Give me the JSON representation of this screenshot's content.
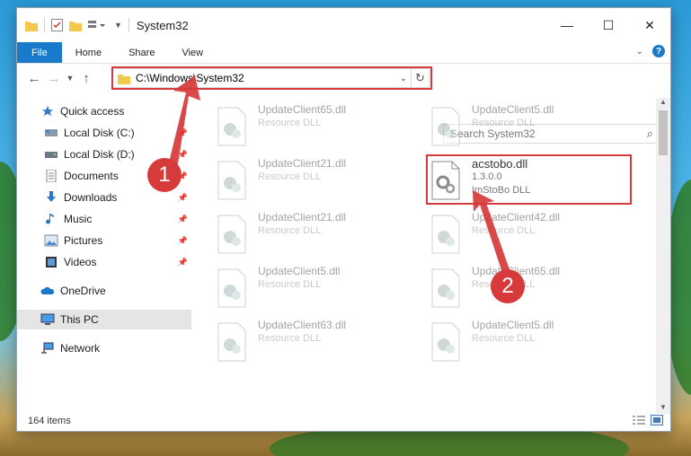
{
  "window": {
    "title": "System32",
    "controls": {
      "minimize": "—",
      "maximize": "☐",
      "close": "✕"
    }
  },
  "ribbon": {
    "tabs": [
      "File",
      "Home",
      "Share",
      "View"
    ],
    "help": "?"
  },
  "address": {
    "path": "C:\\Windows\\System32",
    "search_placeholder": "Search System32"
  },
  "sidebar": {
    "items": [
      {
        "label": "Quick access",
        "icon": "star-icon",
        "pinned": false
      },
      {
        "label": "Local Disk (C:)",
        "icon": "drive-icon",
        "pinned": true
      },
      {
        "label": "Local Disk (D:)",
        "icon": "drive-icon",
        "pinned": true
      },
      {
        "label": "Documents",
        "icon": "documents-icon",
        "pinned": true
      },
      {
        "label": "Downloads",
        "icon": "download-icon",
        "pinned": true
      },
      {
        "label": "Music",
        "icon": "music-icon",
        "pinned": true
      },
      {
        "label": "Pictures",
        "icon": "pictures-icon",
        "pinned": true
      },
      {
        "label": "Videos",
        "icon": "videos-icon",
        "pinned": true
      },
      {
        "label": "OneDrive",
        "icon": "cloud-icon",
        "pinned": false
      },
      {
        "label": "This PC",
        "icon": "computer-icon",
        "pinned": false
      },
      {
        "label": "Network",
        "icon": "network-icon",
        "pinned": false
      }
    ]
  },
  "files": [
    {
      "name": "UpdateClient65.dll",
      "desc": "Resource DLL"
    },
    {
      "name": "UpdateClient5.dll",
      "desc": "Resource DLL"
    },
    {
      "name": "UpdateClient21.dll",
      "desc": "Resource DLL"
    },
    {
      "name": "acstobo.dll",
      "version": "1.3.0.0",
      "desc": "ImStoBo DLL"
    },
    {
      "name": "UpdateClient21.dll",
      "desc": "Resource DLL"
    },
    {
      "name": "UpdateClient42.dll",
      "desc": "Resource DLL"
    },
    {
      "name": "UpdateClient5.dll",
      "desc": "Resource DLL"
    },
    {
      "name": "UpdateClient65.dll",
      "desc": "Resource DLL"
    },
    {
      "name": "UpdateClient63.dll",
      "desc": "Resource DLL"
    },
    {
      "name": "UpdateClient5.dll",
      "desc": "Resource DLL"
    }
  ],
  "status": {
    "count": "164 items"
  },
  "annotations": {
    "badge1": "1",
    "badge2": "2",
    "color": "#d73a3a"
  }
}
